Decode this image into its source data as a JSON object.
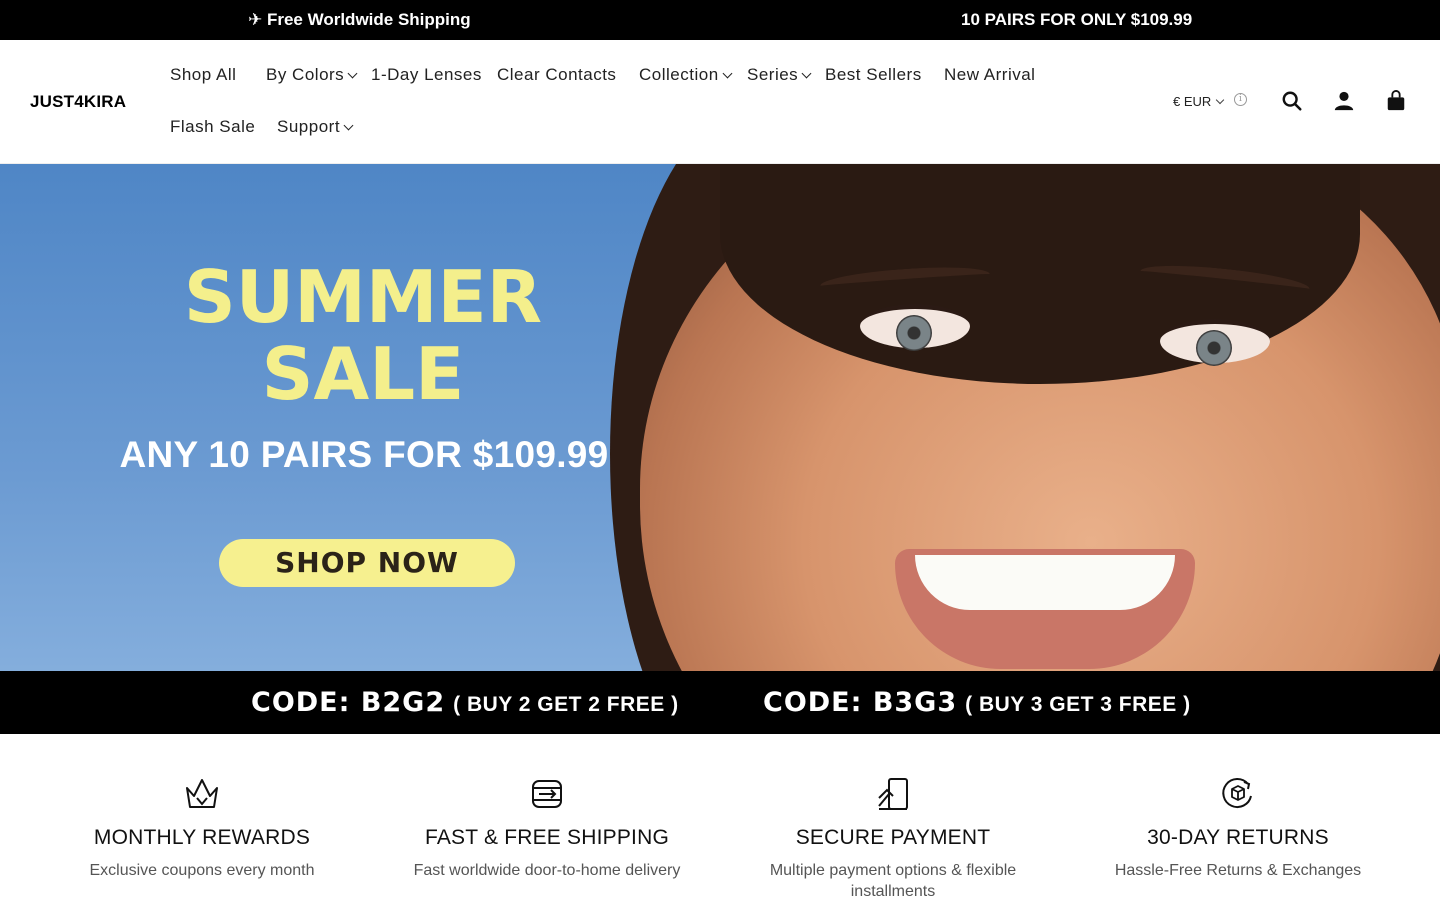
{
  "announcement": {
    "left": "✈ Free Worldwide Shipping",
    "right": "10 PAIRS FOR ONLY $109.99"
  },
  "header": {
    "logo": "JUST4KIRA",
    "nav": [
      {
        "label": "Shop All",
        "has_dropdown": false
      },
      {
        "label": "By Colors",
        "has_dropdown": true
      },
      {
        "label": "1-Day Lenses",
        "has_dropdown": false
      },
      {
        "label": "Clear Contacts",
        "has_dropdown": false
      },
      {
        "label": "Collection",
        "has_dropdown": true
      },
      {
        "label": "Series",
        "has_dropdown": true
      },
      {
        "label": "Best Sellers",
        "has_dropdown": false
      },
      {
        "label": "New Arrival",
        "has_dropdown": false
      },
      {
        "label": "Flash Sale",
        "has_dropdown": false
      },
      {
        "label": "Support",
        "has_dropdown": true
      }
    ],
    "currency": "€ EUR",
    "icons": [
      "info-icon",
      "search-icon",
      "account-icon",
      "cart-icon"
    ]
  },
  "hero": {
    "title_line1": "SUMMER",
    "title_line2": "SALE",
    "subtitle": "ANY 10 PAIRS FOR $109.99",
    "cta": "SHOP NOW",
    "codes": [
      {
        "code": "CODE: B2G2",
        "desc": "( BUY 2 GET 2 FREE )"
      },
      {
        "code": "CODE: B3G3",
        "desc": "( BUY 3 GET 3 FREE )"
      }
    ],
    "colors": {
      "title": "#f4ef8c",
      "button": "#f6f08f",
      "sky": "#5b8fcc"
    }
  },
  "features": [
    {
      "icon": "crown-icon",
      "title": "MONTHLY REWARDS",
      "desc": "Exclusive coupons every month"
    },
    {
      "icon": "shipping-icon",
      "title": "FAST & FREE SHIPPING",
      "desc": "Fast worldwide door-to-home delivery"
    },
    {
      "icon": "secure-payment-icon",
      "title": "SECURE PAYMENT",
      "desc": "Multiple payment options & flexible installments"
    },
    {
      "icon": "returns-icon",
      "title": "30-DAY RETURNS",
      "desc": "Hassle-Free Returns & Exchanges"
    }
  ]
}
